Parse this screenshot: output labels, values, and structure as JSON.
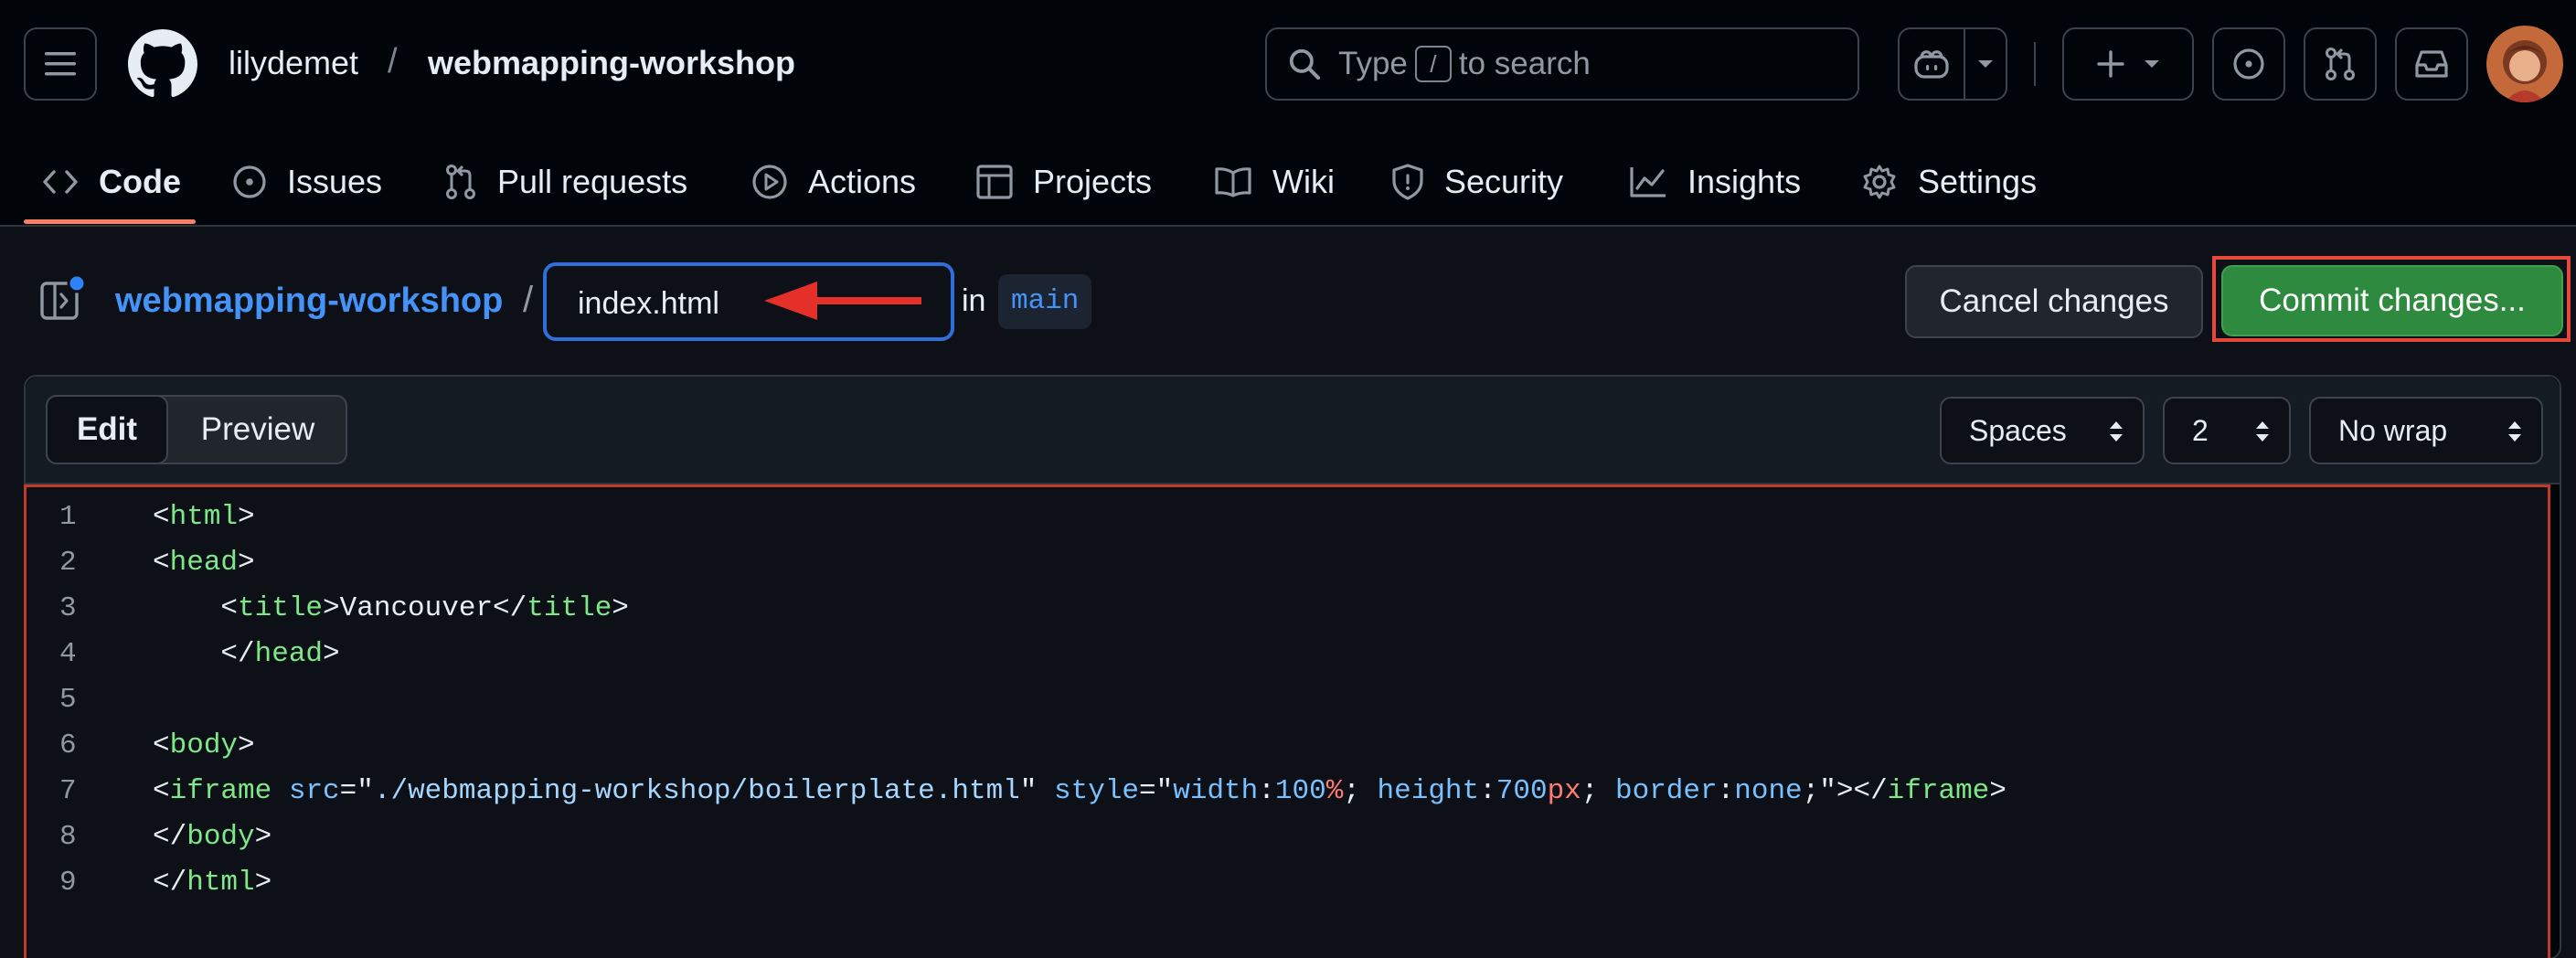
{
  "header": {
    "owner": "lilydemet",
    "separator": "/",
    "repo": "webmapping-workshop",
    "search": {
      "prefix": "Type",
      "key": "/",
      "suffix": "to search"
    }
  },
  "tabs": [
    {
      "label": "Code",
      "icon": "code-icon",
      "active": true
    },
    {
      "label": "Issues",
      "icon": "issue-opened-icon"
    },
    {
      "label": "Pull requests",
      "icon": "git-pull-request-icon"
    },
    {
      "label": "Actions",
      "icon": "play-icon"
    },
    {
      "label": "Projects",
      "icon": "table-icon"
    },
    {
      "label": "Wiki",
      "icon": "book-icon"
    },
    {
      "label": "Security",
      "icon": "shield-icon"
    },
    {
      "label": "Insights",
      "icon": "graph-icon"
    },
    {
      "label": "Settings",
      "icon": "gear-icon"
    }
  ],
  "editor_header": {
    "repo_link": "webmapping-workshop",
    "separator": "/",
    "filename": "index.html",
    "in_label": "in",
    "branch": "main",
    "cancel_label": "Cancel changes",
    "commit_label": "Commit changes..."
  },
  "editor": {
    "mode_edit": "Edit",
    "mode_preview": "Preview",
    "indent_mode": "Spaces",
    "indent_size": "2",
    "wrap_mode": "No wrap"
  },
  "code_lines": [
    {
      "n": "1",
      "text": "<html>"
    },
    {
      "n": "2",
      "text": "<head>"
    },
    {
      "n": "3",
      "text": "    <title>Vancouver</title>"
    },
    {
      "n": "4",
      "text": "    </head>"
    },
    {
      "n": "5",
      "text": ""
    },
    {
      "n": "6",
      "text": "<body>"
    },
    {
      "n": "7",
      "text": "<iframe src=\"./webmapping-workshop/boilerplate.html\" style=\"width:100%; height:700px; border:none;\"></iframe>"
    },
    {
      "n": "8",
      "text": "</body>"
    },
    {
      "n": "9",
      "text": "</html>"
    }
  ],
  "colors": {
    "accent_blue": "#4493f8",
    "commit_green": "#2e8a3e",
    "annotation_red": "#e5483a",
    "tab_underline": "#f78166"
  }
}
